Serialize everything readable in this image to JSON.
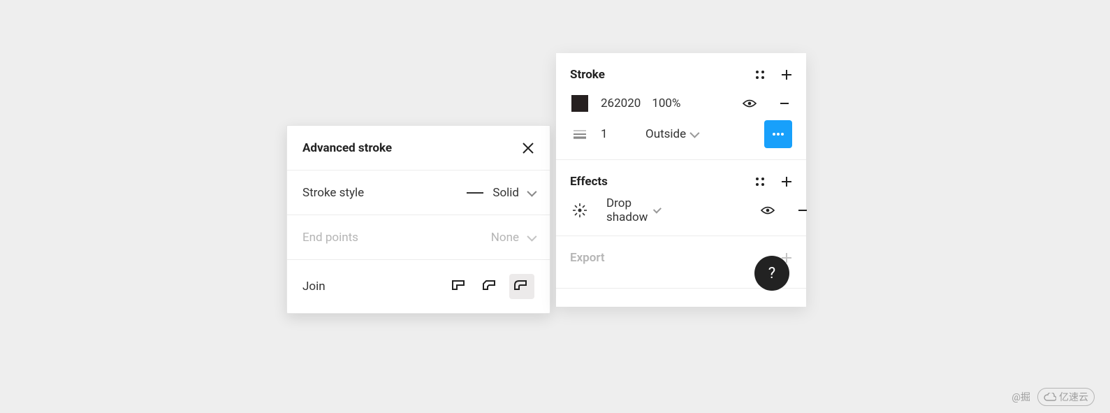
{
  "advanced": {
    "title": "Advanced stroke",
    "stroke_style_label": "Stroke style",
    "stroke_style_value": "Solid",
    "end_points_label": "End points",
    "end_points_value": "None",
    "join_label": "Join"
  },
  "inspector": {
    "stroke": {
      "title": "Stroke",
      "color_hex": "262020",
      "opacity": "100%",
      "weight": "1",
      "position": "Outside"
    },
    "effects": {
      "title": "Effects",
      "item_label": "Drop shadow"
    },
    "export": {
      "title": "Export"
    }
  },
  "watermark": {
    "src": "@掘",
    "brand": "亿速云"
  },
  "colors": {
    "accent": "#18a0fb",
    "swatch": "#262020"
  }
}
